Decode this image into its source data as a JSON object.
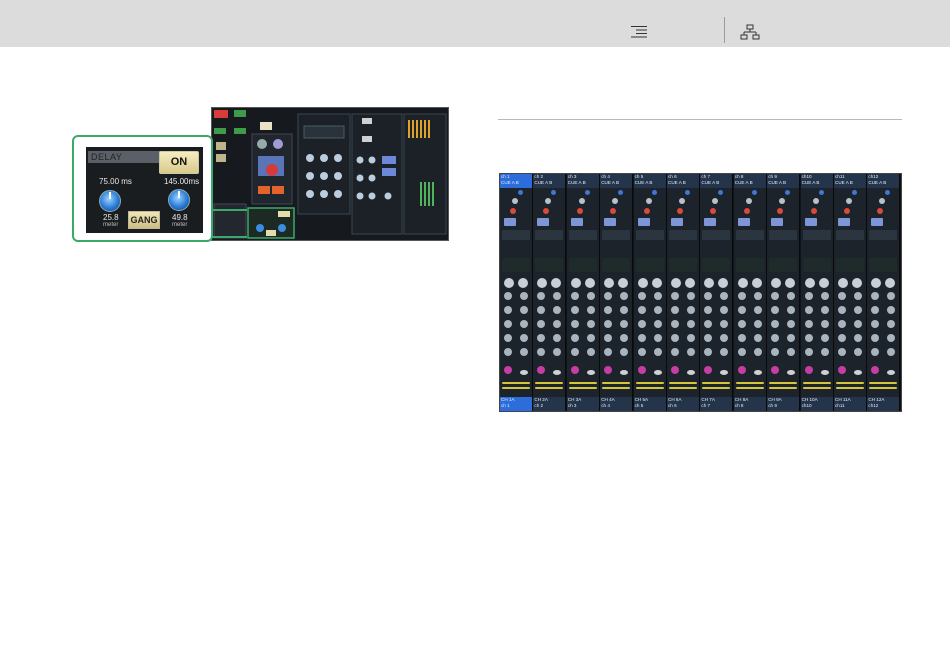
{
  "colors": {
    "topbar": "#dcdcdc",
    "callout": "#3aaa6a",
    "on_button": "#e8dca4",
    "knob": "#2a7bd6"
  },
  "header": {
    "contents_icon": "list-icon",
    "sitemap_icon": "sitemap-icon"
  },
  "delay_callout": {
    "title": "DELAY",
    "on_label": "ON",
    "gang_label": "GANG",
    "left_time": "75.00 ms",
    "right_time": "145.00ms",
    "left_distance": "25.8",
    "right_distance": "49.8",
    "left_unit": "meter",
    "right_unit": "meter"
  },
  "channel_strips": [
    {
      "header_name": "ch 1",
      "cue": "CUE A B",
      "footer_name": "CH 1A",
      "footer_label": "ch 1"
    },
    {
      "header_name": "ch 2",
      "cue": "CUE A B",
      "footer_name": "CH 2A",
      "footer_label": "ch 2"
    },
    {
      "header_name": "ch 3",
      "cue": "CUE A B",
      "footer_name": "CH 3A",
      "footer_label": "ch 3"
    },
    {
      "header_name": "ch 4",
      "cue": "CUE A B",
      "footer_name": "CH 4A",
      "footer_label": "ch 4"
    },
    {
      "header_name": "ch 5",
      "cue": "CUE A B",
      "footer_name": "CH 5A",
      "footer_label": "ch 5"
    },
    {
      "header_name": "ch 6",
      "cue": "CUE A B",
      "footer_name": "CH 6A",
      "footer_label": "ch 6"
    },
    {
      "header_name": "ch 7",
      "cue": "CUE A B",
      "footer_name": "CH 7A",
      "footer_label": "ch 7"
    },
    {
      "header_name": "ch 8",
      "cue": "CUE A B",
      "footer_name": "CH 8A",
      "footer_label": "ch 8"
    },
    {
      "header_name": "ch 9",
      "cue": "CUE A B",
      "footer_name": "CH 9A",
      "footer_label": "ch 9"
    },
    {
      "header_name": "ch10",
      "cue": "CUE A B",
      "footer_name": "CH 10A",
      "footer_label": "ch10"
    },
    {
      "header_name": "ch11",
      "cue": "CUE A B",
      "footer_name": "CH 11A",
      "footer_label": "ch11"
    },
    {
      "header_name": "ch12",
      "cue": "CUE A B",
      "footer_name": "CH 12A",
      "footer_label": "ch12"
    }
  ]
}
